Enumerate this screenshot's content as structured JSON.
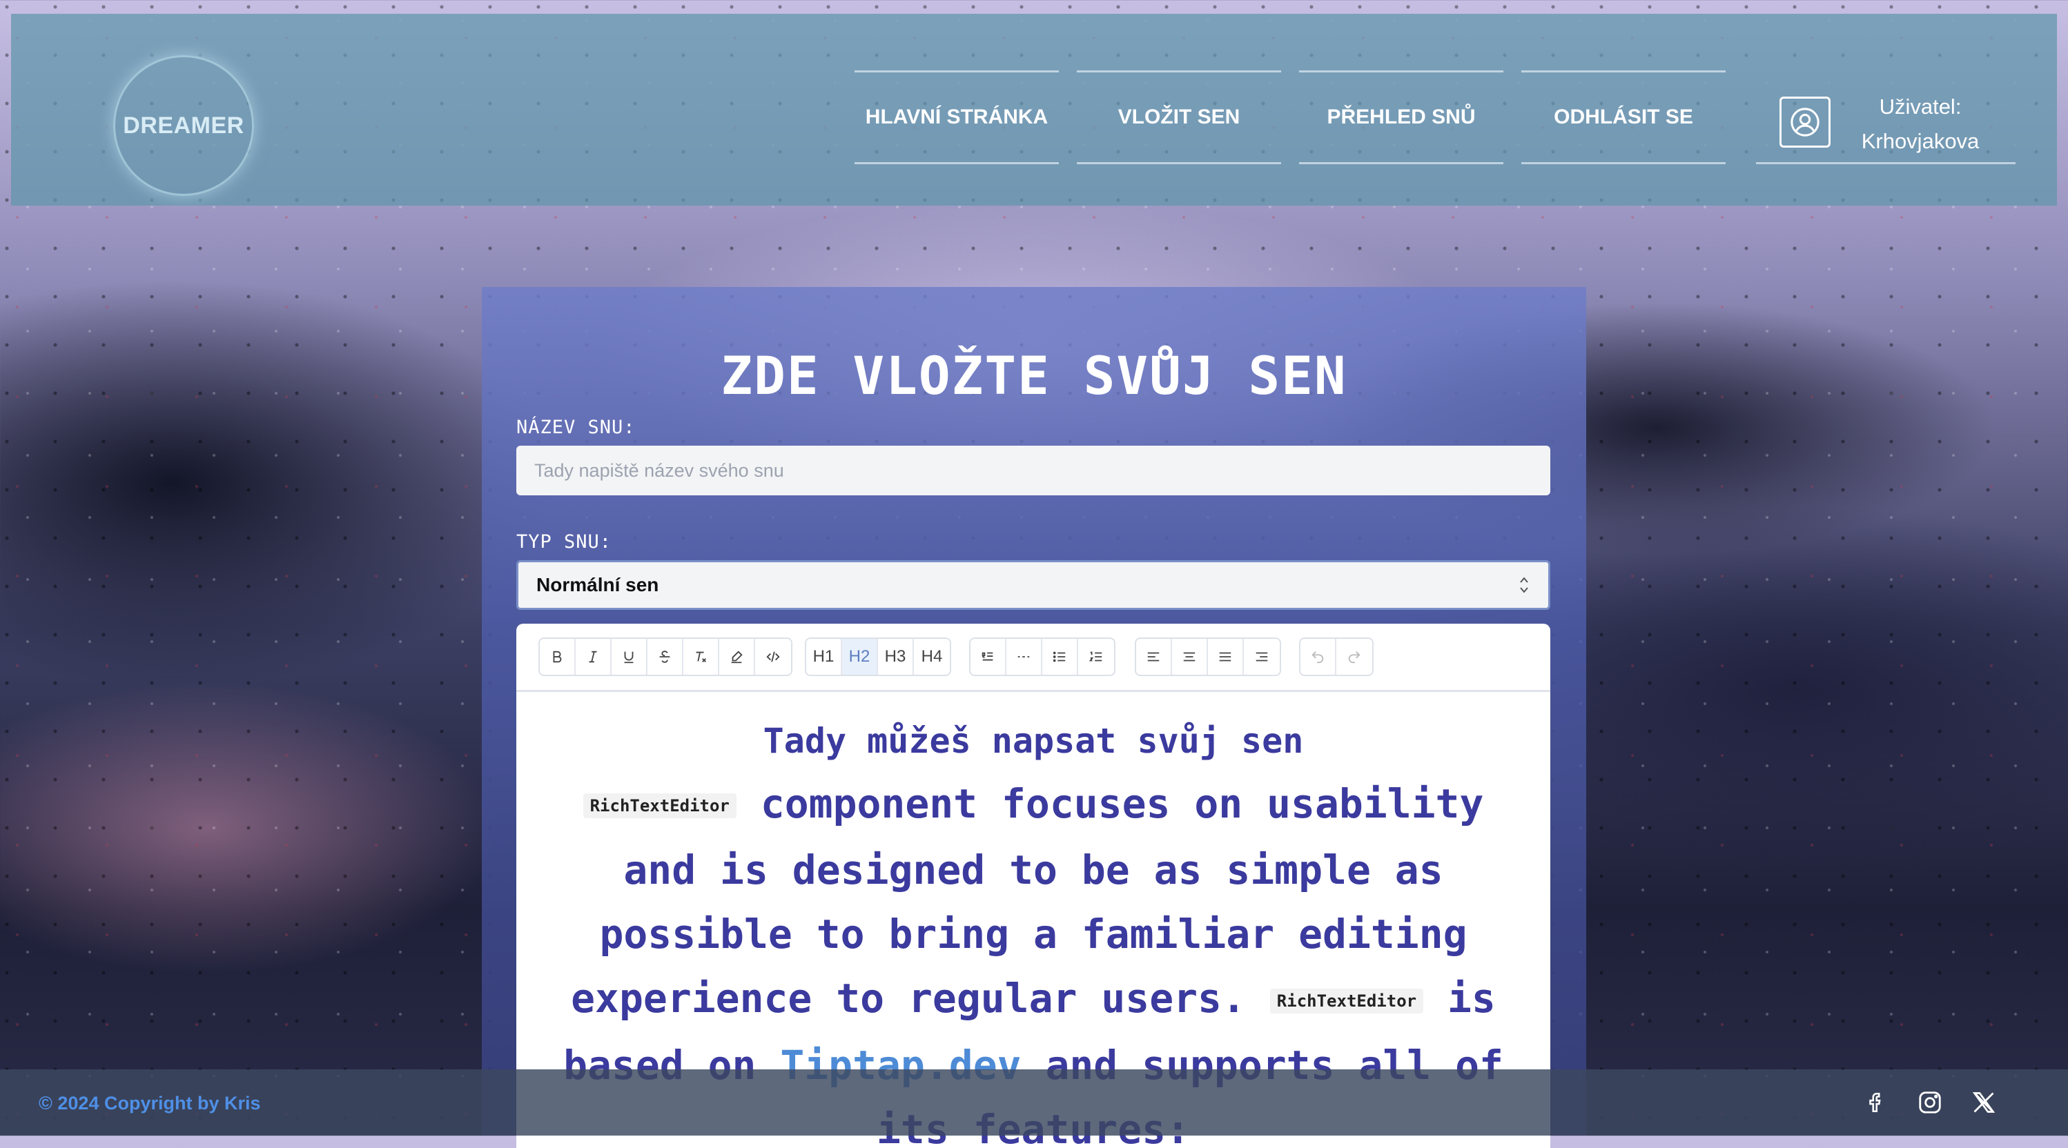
{
  "header": {
    "logo": "DREAMER",
    "nav": [
      "HLAVNÍ STRÁNKA",
      "VLOŽIT SEN",
      "PŘEHLED SNŮ",
      "ODHLÁSIT SE"
    ],
    "user_label": "Uživatel:",
    "user_name": "Krhovjakova"
  },
  "form": {
    "title": "ZDE VLOŽTE SVŮJ SEN",
    "name_label": "NÁZEV SNU:",
    "name_placeholder": "Tady napiště název svého snu",
    "type_label": "TYP SNU:",
    "type_value": "Normální sen"
  },
  "editor": {
    "toolbar": {
      "format": [
        "bold-icon",
        "italic-icon",
        "underline-icon",
        "strike-icon",
        "clear-format-icon",
        "highlight-icon",
        "code-icon"
      ],
      "headings": [
        "H1",
        "H2",
        "H3",
        "H4"
      ],
      "heading_active": "H2",
      "blocks": [
        "blockquote-icon",
        "horizontal-rule-icon",
        "bullet-list-icon",
        "ordered-list-icon"
      ],
      "align": [
        "align-left-icon",
        "align-center-icon",
        "align-justify-icon",
        "align-right-icon"
      ],
      "history": [
        "undo-icon",
        "redo-icon"
      ]
    },
    "heading": "Tady můžeš napsat svůj sen",
    "code_1": "RichTextEditor",
    "text_1": "component focuses on usability and is designed to be as simple as possible to bring a familiar editing experience to regular users.",
    "code_2": "RichTextEditor",
    "text_2": "is based on",
    "link": "Tiptap.dev",
    "text_3": "and supports all of its features:"
  },
  "footer": {
    "copyright": "© 2024 Copyright by Kris",
    "social": [
      "facebook-icon",
      "instagram-icon",
      "x-icon"
    ]
  },
  "colors": {
    "header_bg": "#5f96aa",
    "card_bg": "#6e7dc8",
    "editor_text": "#3b3a9e",
    "link": "#4d8bd6",
    "footer_link": "#4f8fe6"
  }
}
